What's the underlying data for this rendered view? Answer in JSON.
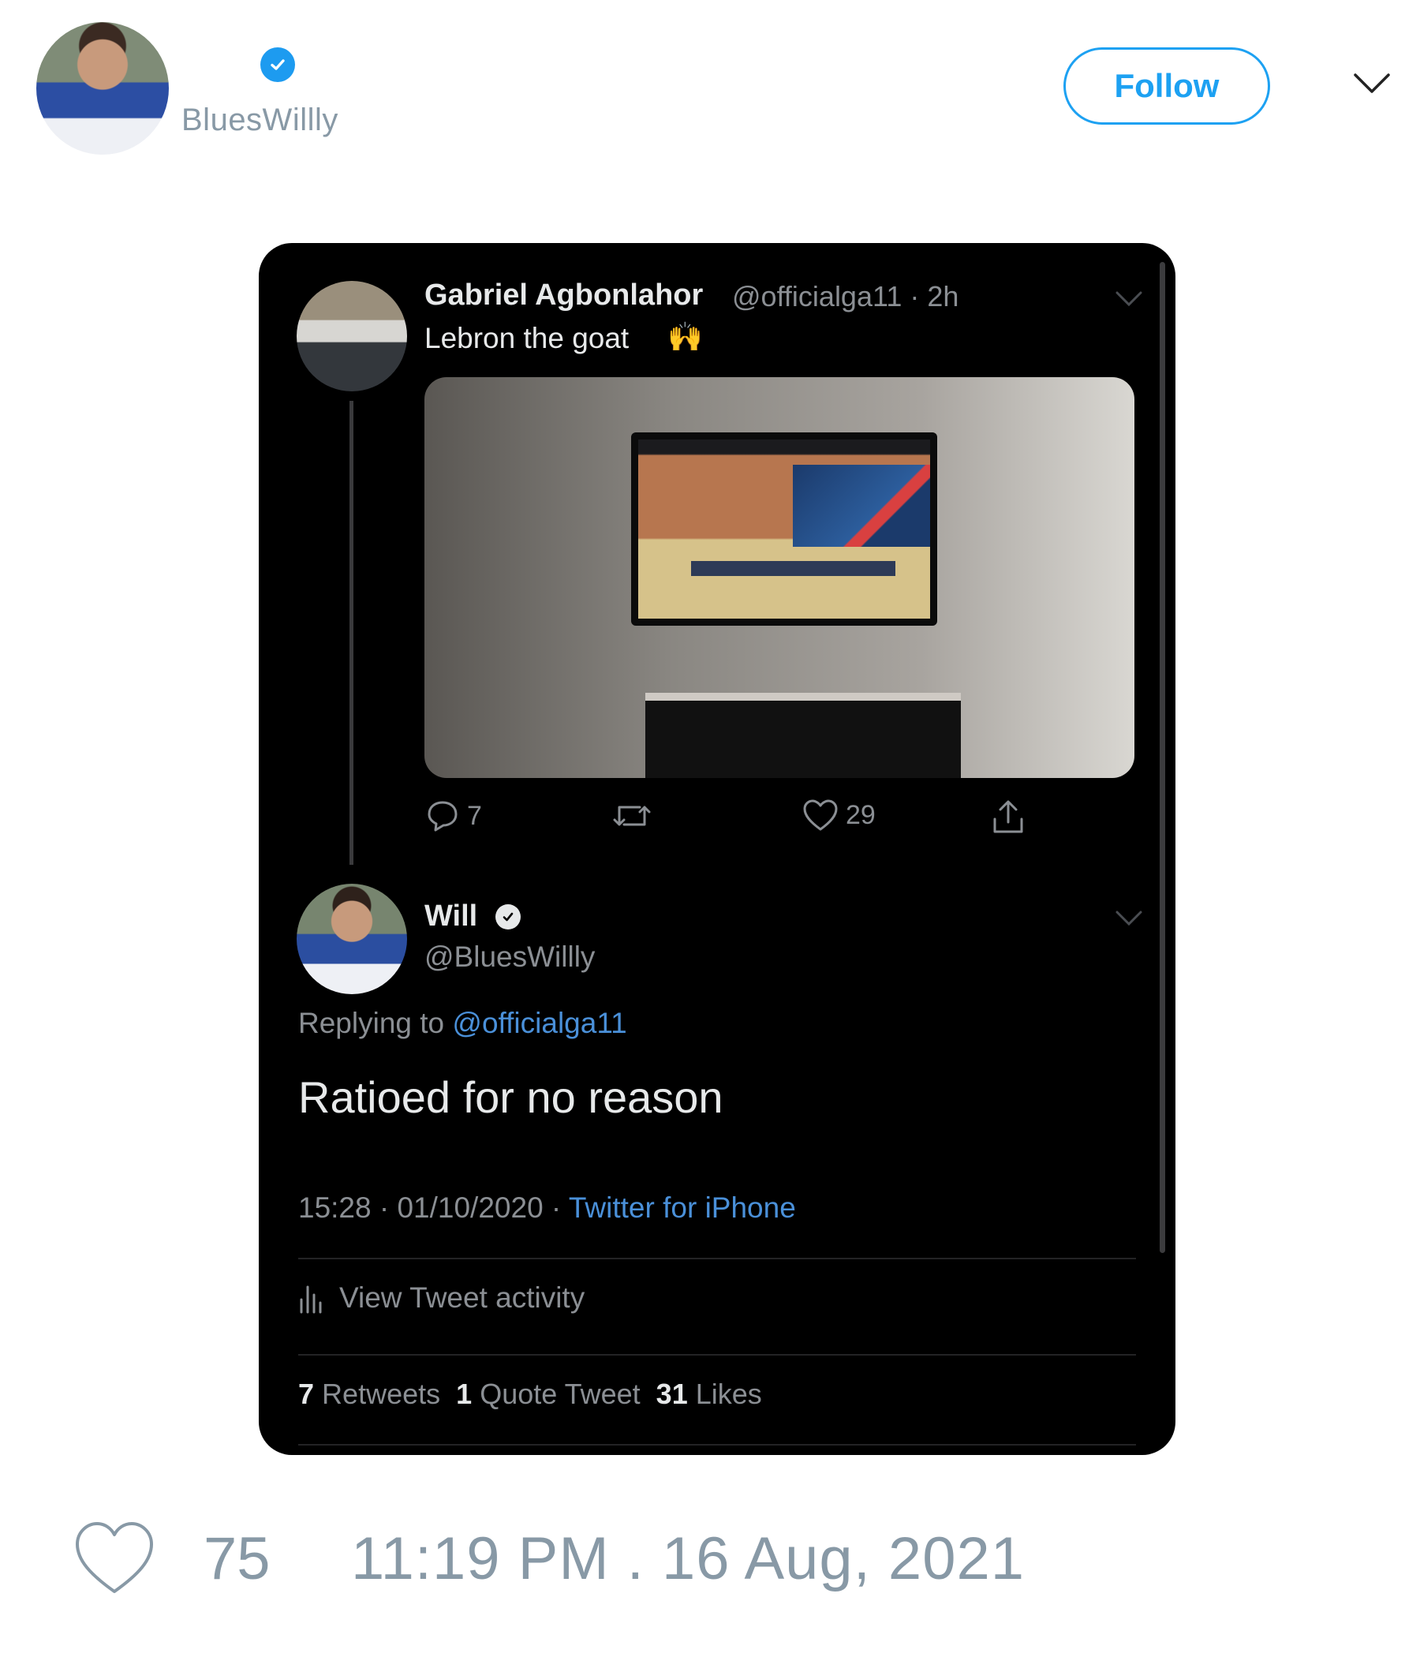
{
  "header": {
    "handle": "BluesWillly",
    "follow_label": "Follow",
    "verified": true
  },
  "embedded": {
    "parent_tweet": {
      "name": "Gabriel Agbonlahor",
      "meta": "@officialga11 · 2h",
      "text": "Lebron the goat",
      "emoji": "🙌",
      "actions": {
        "reply_count": "7",
        "retweet_count": "",
        "like_count": "29"
      }
    },
    "reply_tweet": {
      "name": "Will",
      "handle": "@BluesWillly",
      "replying_prefix": "Replying to ",
      "replying_mention": "@officialga11",
      "text": "Ratioed for no reason",
      "time_date": "15:28 · 01/10/2020 · ",
      "source": "Twitter for iPhone",
      "activity_label": "View Tweet activity",
      "stats": {
        "retweets_num": "7",
        "retweets_label": "Retweets",
        "quotes_num": "1",
        "quotes_label": "Quote Tweet",
        "likes_num": "31",
        "likes_label": "Likes"
      }
    }
  },
  "footer": {
    "like_count": "75",
    "timestamp": "11:19 PM . 16 Aug, 2021"
  },
  "colors": {
    "accent": "#1da1f2",
    "muted": "#8899a6",
    "dark_bg": "#000000",
    "link_dark": "#4a90d9"
  },
  "icons": [
    "verified-badge-icon",
    "chevron-down-icon",
    "reply-icon",
    "retweet-icon",
    "like-icon",
    "share-icon",
    "bar-chart-icon",
    "heart-icon"
  ]
}
